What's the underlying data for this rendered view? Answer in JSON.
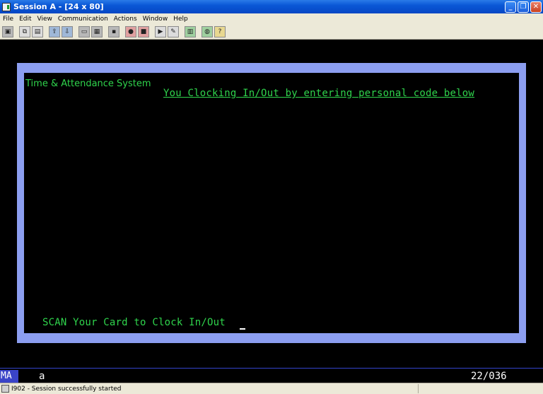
{
  "window": {
    "title": "Session A - [24 x 80]",
    "controls": [
      "minimize",
      "restore",
      "close"
    ]
  },
  "menubar": {
    "items": [
      {
        "label": "File"
      },
      {
        "label": "Edit"
      },
      {
        "label": "View"
      },
      {
        "label": "Communication"
      },
      {
        "label": "Actions"
      },
      {
        "label": "Window"
      },
      {
        "label": "Help"
      }
    ]
  },
  "toolbar": {
    "icons": [
      "print-screen-icon",
      "copy-icon",
      "paste-icon",
      "send-file-icon",
      "receive-file-icon",
      "display-icon",
      "keyboard-icon",
      "macro-icon",
      "record-macro-icon",
      "stop-macro-icon",
      "play-macro-icon",
      "customize-icon",
      "edit-icon",
      "globe-icon",
      "help-icon"
    ]
  },
  "terminal": {
    "system_title": "Time & Attendance System",
    "instruction": "You Clocking In/Out by entering personal code below",
    "scan_prompt": "SCAN Your Card to Clock In/Out"
  },
  "oia": {
    "indicator": "MA",
    "mode": "a",
    "cursor_position": "22/036"
  },
  "statusbar": {
    "message": "I902 - Session successfully started"
  },
  "colors": {
    "screen_text": "#2fd44c",
    "frame": "#8c9ef0",
    "background": "#000000",
    "title_bar": "#0a57d6",
    "chrome": "#ece9d8"
  }
}
